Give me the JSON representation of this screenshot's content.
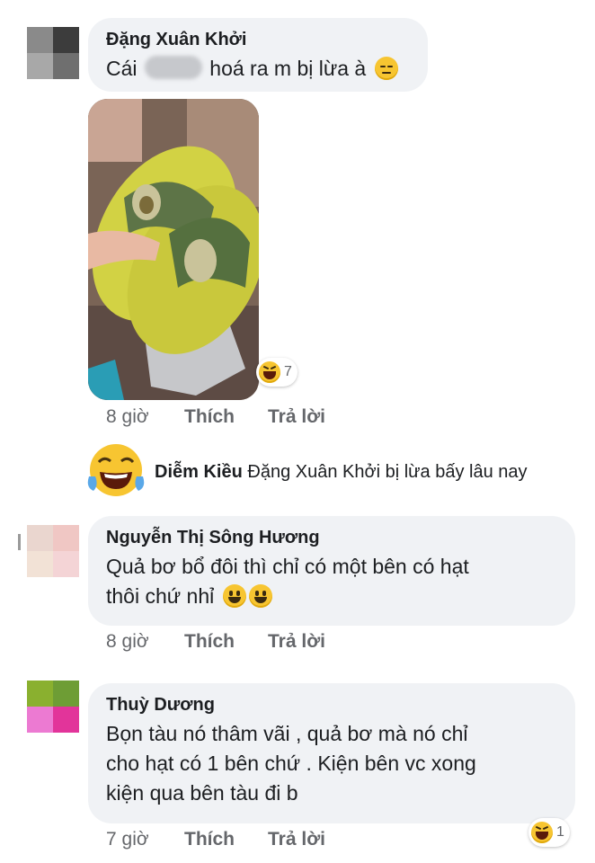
{
  "comments": [
    {
      "author": "Đặng Xuân Khởi",
      "text_before": "Cái",
      "text_after": "hoá ra m bị lừa à",
      "emoji": "pensive-face",
      "time": "8 giờ",
      "like": "Thích",
      "reply": "Trả lời",
      "reaction": {
        "icon": "haha-icon",
        "count": "7"
      },
      "image": "green-avocado-slippers-photo"
    },
    {
      "reply_author": "Diễm Kiều",
      "reply_mention": "Đặng Xuân Khởi",
      "reply_text": "bị lừa bấy lâu nay",
      "sticker": "tears-of-joy-face"
    },
    {
      "author": "Nguyễn Thị Sông Hương",
      "line1": "Quả bơ bổ đôi thì chỉ có một bên có hạt",
      "line2": "thôi chứ nhỉ",
      "emoji": "grinning-face",
      "time": "8 giờ",
      "like": "Thích",
      "reply": "Trả lời"
    },
    {
      "author": "Thuỳ Dương",
      "line1": "Bọn tàu nó thâm vãi , quả bơ mà nó chỉ",
      "line2": "cho hạt có 1 bên chứ . Kiện bên vc xong",
      "line3": "kiện qua bên tàu đi b",
      "time": "7 giờ",
      "like": "Thích",
      "reply": "Trả lời",
      "reaction": {
        "icon": "haha-icon",
        "count": "1"
      }
    }
  ],
  "colors": {
    "bubble": "#f0f2f5",
    "meta": "#65676b",
    "text": "#1c1e21"
  }
}
